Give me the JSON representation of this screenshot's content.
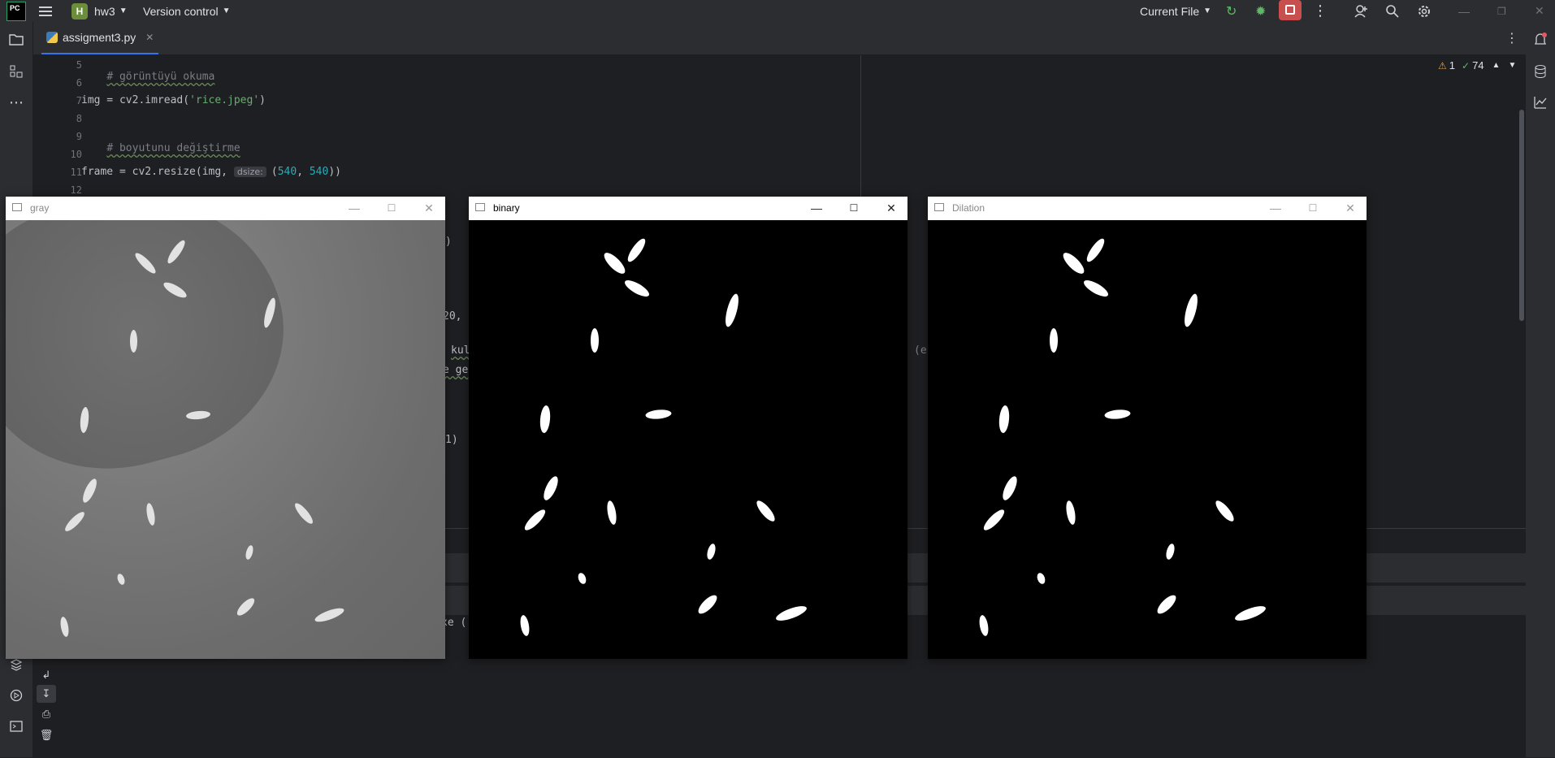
{
  "titlebar": {
    "project_initial": "H",
    "project_name": "hw3",
    "vcs_label": "Version control",
    "run_config": "Current File"
  },
  "tabs": [
    {
      "label": "assigment3.py"
    }
  ],
  "editor": {
    "lines": [
      {
        "n": "5",
        "comment": "# görüntüyü okuma"
      },
      {
        "n": "6"
      },
      {
        "n": "7",
        "code_a": "img = cv2.imread(",
        "str": "'rice.jpeg'",
        "code_b": ")"
      },
      {
        "n": "8"
      },
      {
        "n": "9",
        "comment": "# boyutunu değiştirme"
      },
      {
        "n": "10"
      },
      {
        "n": "11",
        "code_a": "frame = cv2.resize(img, ",
        "hint": "dsize:",
        "paren": "(",
        "num1": "540",
        "sep": ", ",
        "num2": "540",
        "close": "))"
      },
      {
        "n": "12"
      }
    ],
    "fragments": [
      ")",
      "20,",
      "kul",
      "e ge",
      "1)",
      "(e",
      "xe ("
    ],
    "inspections": {
      "warnings": "1",
      "ok": "74"
    }
  },
  "windows": [
    {
      "title": "gray",
      "active": false
    },
    {
      "title": "binary",
      "active": true
    },
    {
      "title": "Dilation",
      "active": false
    }
  ],
  "icons": {
    "app": "pycharm-logo-icon",
    "menu": "hamburger-menu-icon",
    "folder": "project-folder-icon",
    "structure": "structure-icon",
    "more": "more-horizontal-icon",
    "notifications": "bell-icon",
    "database": "database-icon",
    "sciview": "chart-icon"
  }
}
